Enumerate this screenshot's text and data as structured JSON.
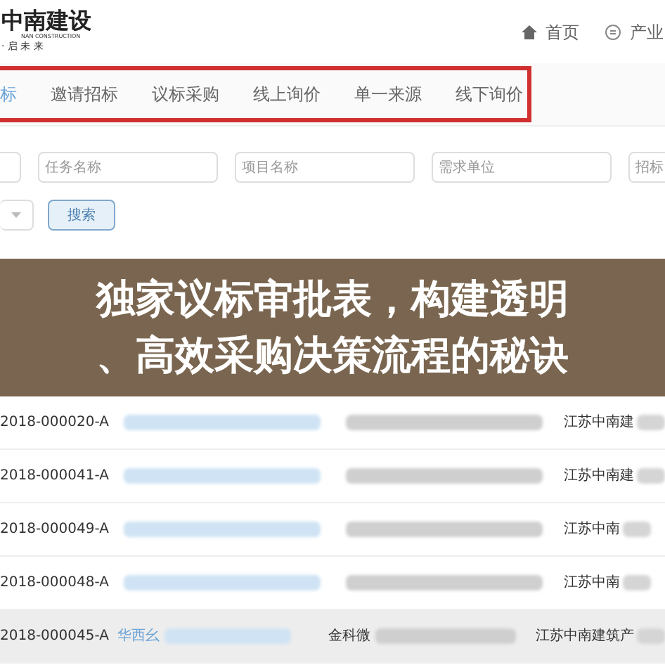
{
  "header": {
    "logo": {
      "name": "中南建设",
      "subtitle": "NAN CONSTRUCTION",
      "slogan": "· 启 未 来"
    },
    "nav": [
      {
        "label": "首页",
        "kind": "home"
      },
      {
        "label": "产业",
        "kind": "circle"
      }
    ]
  },
  "tabs": [
    {
      "label": "标",
      "selected": true
    },
    {
      "label": "邀请招标",
      "selected": false
    },
    {
      "label": "议标采购",
      "selected": false
    },
    {
      "label": "线上询价",
      "selected": false
    },
    {
      "label": "单一来源",
      "selected": false
    },
    {
      "label": "线下询价",
      "selected": false
    }
  ],
  "filters": {
    "fields": [
      {
        "kind": "input"
      },
      {
        "kind": "input",
        "placeholder": "任务名称"
      },
      {
        "kind": "input",
        "placeholder": "项目名称"
      },
      {
        "kind": "input",
        "placeholder": "需求单位"
      },
      {
        "kind": "input",
        "placeholder": "招标"
      }
    ],
    "search_button": "搜索"
  },
  "table": {
    "rows": [
      {
        "code": "2018-000020-A",
        "unit": "江苏中南建",
        "highlighted": false
      },
      {
        "code": "2018-000041-A",
        "unit": "江苏中南建",
        "highlighted": false
      },
      {
        "code": "2018-000049-A",
        "unit": "江苏中南",
        "highlighted": false
      },
      {
        "code": "2018-000048-A",
        "unit": "江苏中南",
        "highlighted": false
      },
      {
        "code": "2018-000045-A",
        "task": "华西幺",
        "project": "金科微",
        "unit": "江苏中南建筑产",
        "highlighted": true
      }
    ]
  },
  "banner": {
    "lines": [
      "独家议标审批表，构建透明",
      "、高效采购决策流程的秘诀"
    ]
  }
}
